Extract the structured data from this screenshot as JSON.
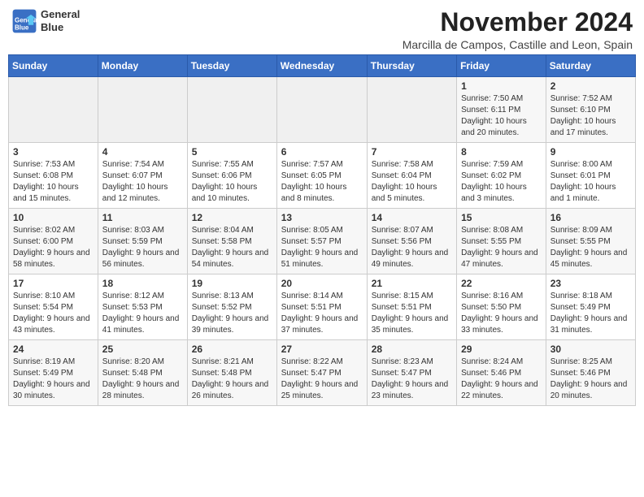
{
  "header": {
    "logo_line1": "General",
    "logo_line2": "Blue",
    "month_title": "November 2024",
    "location": "Marcilla de Campos, Castille and Leon, Spain"
  },
  "weekdays": [
    "Sunday",
    "Monday",
    "Tuesday",
    "Wednesday",
    "Thursday",
    "Friday",
    "Saturday"
  ],
  "weeks": [
    [
      {
        "day": "",
        "info": ""
      },
      {
        "day": "",
        "info": ""
      },
      {
        "day": "",
        "info": ""
      },
      {
        "day": "",
        "info": ""
      },
      {
        "day": "",
        "info": ""
      },
      {
        "day": "1",
        "info": "Sunrise: 7:50 AM\nSunset: 6:11 PM\nDaylight: 10 hours and 20 minutes."
      },
      {
        "day": "2",
        "info": "Sunrise: 7:52 AM\nSunset: 6:10 PM\nDaylight: 10 hours and 17 minutes."
      }
    ],
    [
      {
        "day": "3",
        "info": "Sunrise: 7:53 AM\nSunset: 6:08 PM\nDaylight: 10 hours and 15 minutes."
      },
      {
        "day": "4",
        "info": "Sunrise: 7:54 AM\nSunset: 6:07 PM\nDaylight: 10 hours and 12 minutes."
      },
      {
        "day": "5",
        "info": "Sunrise: 7:55 AM\nSunset: 6:06 PM\nDaylight: 10 hours and 10 minutes."
      },
      {
        "day": "6",
        "info": "Sunrise: 7:57 AM\nSunset: 6:05 PM\nDaylight: 10 hours and 8 minutes."
      },
      {
        "day": "7",
        "info": "Sunrise: 7:58 AM\nSunset: 6:04 PM\nDaylight: 10 hours and 5 minutes."
      },
      {
        "day": "8",
        "info": "Sunrise: 7:59 AM\nSunset: 6:02 PM\nDaylight: 10 hours and 3 minutes."
      },
      {
        "day": "9",
        "info": "Sunrise: 8:00 AM\nSunset: 6:01 PM\nDaylight: 10 hours and 1 minute."
      }
    ],
    [
      {
        "day": "10",
        "info": "Sunrise: 8:02 AM\nSunset: 6:00 PM\nDaylight: 9 hours and 58 minutes."
      },
      {
        "day": "11",
        "info": "Sunrise: 8:03 AM\nSunset: 5:59 PM\nDaylight: 9 hours and 56 minutes."
      },
      {
        "day": "12",
        "info": "Sunrise: 8:04 AM\nSunset: 5:58 PM\nDaylight: 9 hours and 54 minutes."
      },
      {
        "day": "13",
        "info": "Sunrise: 8:05 AM\nSunset: 5:57 PM\nDaylight: 9 hours and 51 minutes."
      },
      {
        "day": "14",
        "info": "Sunrise: 8:07 AM\nSunset: 5:56 PM\nDaylight: 9 hours and 49 minutes."
      },
      {
        "day": "15",
        "info": "Sunrise: 8:08 AM\nSunset: 5:55 PM\nDaylight: 9 hours and 47 minutes."
      },
      {
        "day": "16",
        "info": "Sunrise: 8:09 AM\nSunset: 5:55 PM\nDaylight: 9 hours and 45 minutes."
      }
    ],
    [
      {
        "day": "17",
        "info": "Sunrise: 8:10 AM\nSunset: 5:54 PM\nDaylight: 9 hours and 43 minutes."
      },
      {
        "day": "18",
        "info": "Sunrise: 8:12 AM\nSunset: 5:53 PM\nDaylight: 9 hours and 41 minutes."
      },
      {
        "day": "19",
        "info": "Sunrise: 8:13 AM\nSunset: 5:52 PM\nDaylight: 9 hours and 39 minutes."
      },
      {
        "day": "20",
        "info": "Sunrise: 8:14 AM\nSunset: 5:51 PM\nDaylight: 9 hours and 37 minutes."
      },
      {
        "day": "21",
        "info": "Sunrise: 8:15 AM\nSunset: 5:51 PM\nDaylight: 9 hours and 35 minutes."
      },
      {
        "day": "22",
        "info": "Sunrise: 8:16 AM\nSunset: 5:50 PM\nDaylight: 9 hours and 33 minutes."
      },
      {
        "day": "23",
        "info": "Sunrise: 8:18 AM\nSunset: 5:49 PM\nDaylight: 9 hours and 31 minutes."
      }
    ],
    [
      {
        "day": "24",
        "info": "Sunrise: 8:19 AM\nSunset: 5:49 PM\nDaylight: 9 hours and 30 minutes."
      },
      {
        "day": "25",
        "info": "Sunrise: 8:20 AM\nSunset: 5:48 PM\nDaylight: 9 hours and 28 minutes."
      },
      {
        "day": "26",
        "info": "Sunrise: 8:21 AM\nSunset: 5:48 PM\nDaylight: 9 hours and 26 minutes."
      },
      {
        "day": "27",
        "info": "Sunrise: 8:22 AM\nSunset: 5:47 PM\nDaylight: 9 hours and 25 minutes."
      },
      {
        "day": "28",
        "info": "Sunrise: 8:23 AM\nSunset: 5:47 PM\nDaylight: 9 hours and 23 minutes."
      },
      {
        "day": "29",
        "info": "Sunrise: 8:24 AM\nSunset: 5:46 PM\nDaylight: 9 hours and 22 minutes."
      },
      {
        "day": "30",
        "info": "Sunrise: 8:25 AM\nSunset: 5:46 PM\nDaylight: 9 hours and 20 minutes."
      }
    ]
  ]
}
